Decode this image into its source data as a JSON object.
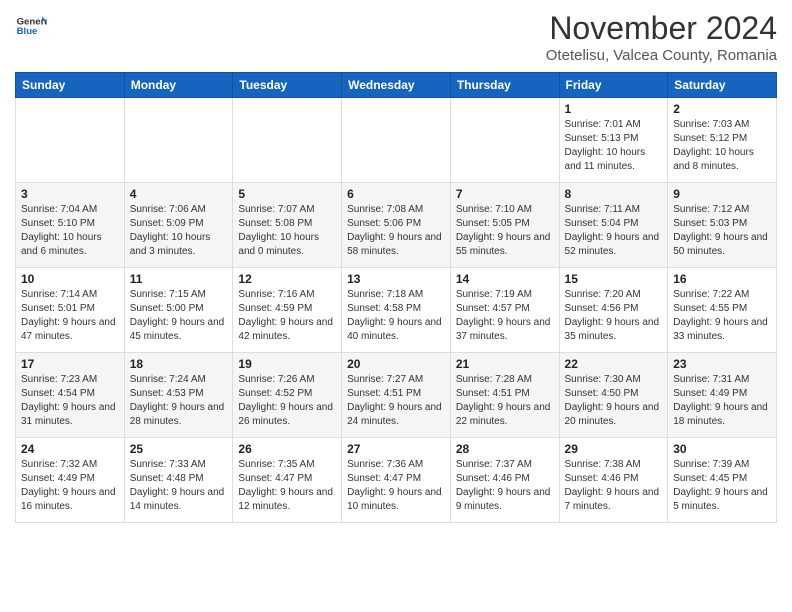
{
  "header": {
    "logo_general": "General",
    "logo_blue": "Blue",
    "title": "November 2024",
    "subtitle": "Otetelisu, Valcea County, Romania"
  },
  "weekdays": [
    "Sunday",
    "Monday",
    "Tuesday",
    "Wednesday",
    "Thursday",
    "Friday",
    "Saturday"
  ],
  "weeks": [
    [
      {
        "day": "",
        "info": ""
      },
      {
        "day": "",
        "info": ""
      },
      {
        "day": "",
        "info": ""
      },
      {
        "day": "",
        "info": ""
      },
      {
        "day": "",
        "info": ""
      },
      {
        "day": "1",
        "info": "Sunrise: 7:01 AM\nSunset: 5:13 PM\nDaylight: 10 hours and 11 minutes."
      },
      {
        "day": "2",
        "info": "Sunrise: 7:03 AM\nSunset: 5:12 PM\nDaylight: 10 hours and 8 minutes."
      }
    ],
    [
      {
        "day": "3",
        "info": "Sunrise: 7:04 AM\nSunset: 5:10 PM\nDaylight: 10 hours and 6 minutes."
      },
      {
        "day": "4",
        "info": "Sunrise: 7:06 AM\nSunset: 5:09 PM\nDaylight: 10 hours and 3 minutes."
      },
      {
        "day": "5",
        "info": "Sunrise: 7:07 AM\nSunset: 5:08 PM\nDaylight: 10 hours and 0 minutes."
      },
      {
        "day": "6",
        "info": "Sunrise: 7:08 AM\nSunset: 5:06 PM\nDaylight: 9 hours and 58 minutes."
      },
      {
        "day": "7",
        "info": "Sunrise: 7:10 AM\nSunset: 5:05 PM\nDaylight: 9 hours and 55 minutes."
      },
      {
        "day": "8",
        "info": "Sunrise: 7:11 AM\nSunset: 5:04 PM\nDaylight: 9 hours and 52 minutes."
      },
      {
        "day": "9",
        "info": "Sunrise: 7:12 AM\nSunset: 5:03 PM\nDaylight: 9 hours and 50 minutes."
      }
    ],
    [
      {
        "day": "10",
        "info": "Sunrise: 7:14 AM\nSunset: 5:01 PM\nDaylight: 9 hours and 47 minutes."
      },
      {
        "day": "11",
        "info": "Sunrise: 7:15 AM\nSunset: 5:00 PM\nDaylight: 9 hours and 45 minutes."
      },
      {
        "day": "12",
        "info": "Sunrise: 7:16 AM\nSunset: 4:59 PM\nDaylight: 9 hours and 42 minutes."
      },
      {
        "day": "13",
        "info": "Sunrise: 7:18 AM\nSunset: 4:58 PM\nDaylight: 9 hours and 40 minutes."
      },
      {
        "day": "14",
        "info": "Sunrise: 7:19 AM\nSunset: 4:57 PM\nDaylight: 9 hours and 37 minutes."
      },
      {
        "day": "15",
        "info": "Sunrise: 7:20 AM\nSunset: 4:56 PM\nDaylight: 9 hours and 35 minutes."
      },
      {
        "day": "16",
        "info": "Sunrise: 7:22 AM\nSunset: 4:55 PM\nDaylight: 9 hours and 33 minutes."
      }
    ],
    [
      {
        "day": "17",
        "info": "Sunrise: 7:23 AM\nSunset: 4:54 PM\nDaylight: 9 hours and 31 minutes."
      },
      {
        "day": "18",
        "info": "Sunrise: 7:24 AM\nSunset: 4:53 PM\nDaylight: 9 hours and 28 minutes."
      },
      {
        "day": "19",
        "info": "Sunrise: 7:26 AM\nSunset: 4:52 PM\nDaylight: 9 hours and 26 minutes."
      },
      {
        "day": "20",
        "info": "Sunrise: 7:27 AM\nSunset: 4:51 PM\nDaylight: 9 hours and 24 minutes."
      },
      {
        "day": "21",
        "info": "Sunrise: 7:28 AM\nSunset: 4:51 PM\nDaylight: 9 hours and 22 minutes."
      },
      {
        "day": "22",
        "info": "Sunrise: 7:30 AM\nSunset: 4:50 PM\nDaylight: 9 hours and 20 minutes."
      },
      {
        "day": "23",
        "info": "Sunrise: 7:31 AM\nSunset: 4:49 PM\nDaylight: 9 hours and 18 minutes."
      }
    ],
    [
      {
        "day": "24",
        "info": "Sunrise: 7:32 AM\nSunset: 4:49 PM\nDaylight: 9 hours and 16 minutes."
      },
      {
        "day": "25",
        "info": "Sunrise: 7:33 AM\nSunset: 4:48 PM\nDaylight: 9 hours and 14 minutes."
      },
      {
        "day": "26",
        "info": "Sunrise: 7:35 AM\nSunset: 4:47 PM\nDaylight: 9 hours and 12 minutes."
      },
      {
        "day": "27",
        "info": "Sunrise: 7:36 AM\nSunset: 4:47 PM\nDaylight: 9 hours and 10 minutes."
      },
      {
        "day": "28",
        "info": "Sunrise: 7:37 AM\nSunset: 4:46 PM\nDaylight: 9 hours and 9 minutes."
      },
      {
        "day": "29",
        "info": "Sunrise: 7:38 AM\nSunset: 4:46 PM\nDaylight: 9 hours and 7 minutes."
      },
      {
        "day": "30",
        "info": "Sunrise: 7:39 AM\nSunset: 4:45 PM\nDaylight: 9 hours and 5 minutes."
      }
    ]
  ]
}
